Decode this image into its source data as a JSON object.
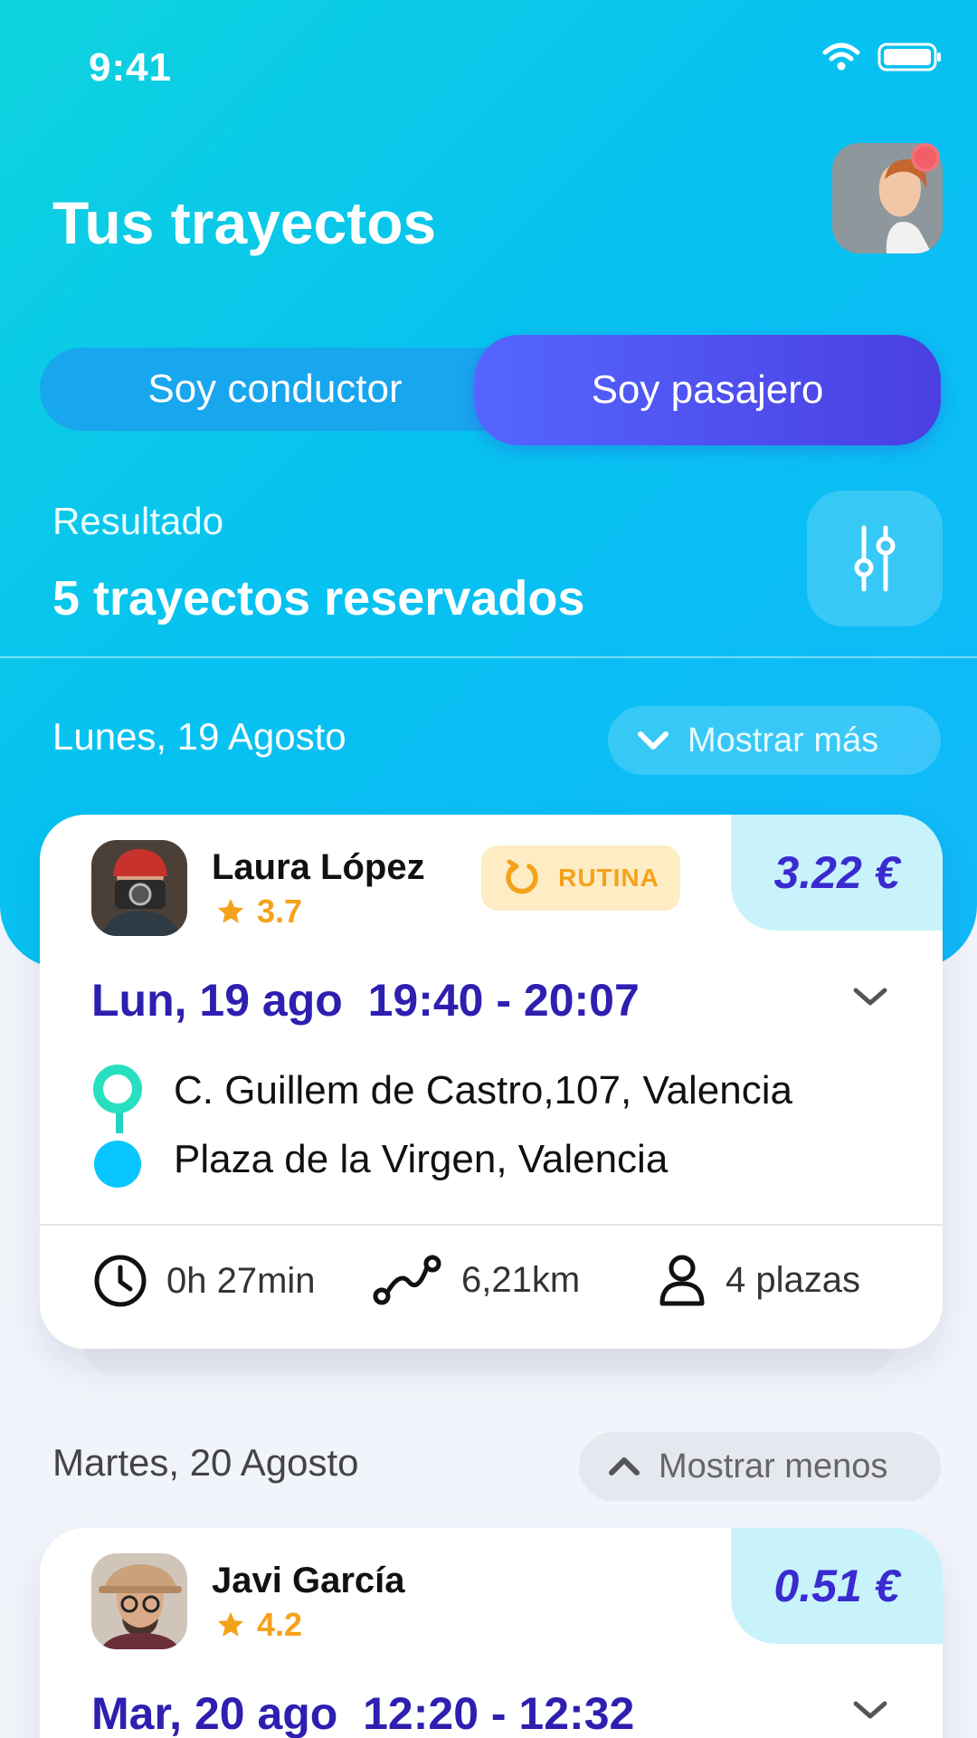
{
  "status_bar": {
    "time": "9:41"
  },
  "header": {
    "title": "Tus trayectos"
  },
  "tabs": [
    {
      "label": "Soy conductor",
      "selected": false
    },
    {
      "label": "Soy pasajero",
      "selected": true
    }
  ],
  "results": {
    "label": "Resultado",
    "count_text": "5 trayectos reservados"
  },
  "days": [
    {
      "label": "Lunes, 19 Agosto",
      "toggle_label": "Mostrar más",
      "trip": {
        "driver": "Laura López",
        "rating": "3.7",
        "badge": "RUTINA",
        "price": "3.22 €",
        "datetime": "Lun, 19 ago  19:40 - 20:07",
        "origin": "C. Guillem de Castro,107, Valencia",
        "destination": "Plaza de la Virgen, Valencia",
        "duration": "0h 27min",
        "distance": "6,21km",
        "seats": "4 plazas"
      }
    },
    {
      "label": "Martes, 20 Agosto",
      "toggle_label": "Mostrar menos",
      "trip": {
        "driver": "Javi García",
        "rating": "4.2",
        "price": "0.51 €",
        "datetime": "Mar, 20 ago  12:20 - 12:32"
      }
    }
  ],
  "colors": {
    "accent": "#4a3fe0",
    "hero_gradient_start": "#0fd3de",
    "hero_gradient_end": "#12b8fb",
    "price_text": "#3a2bd0",
    "rating": "#f5a21b",
    "notification": "#f25d66"
  },
  "icons": {
    "wifi": "wifi-icon",
    "battery": "battery-icon",
    "filter": "sliders-icon",
    "chevron_down": "chevron-down-icon",
    "chevron_up": "chevron-up-icon",
    "routine": "refresh-icon",
    "star": "star-icon",
    "clock": "clock-icon",
    "route": "route-icon",
    "person": "person-icon"
  }
}
